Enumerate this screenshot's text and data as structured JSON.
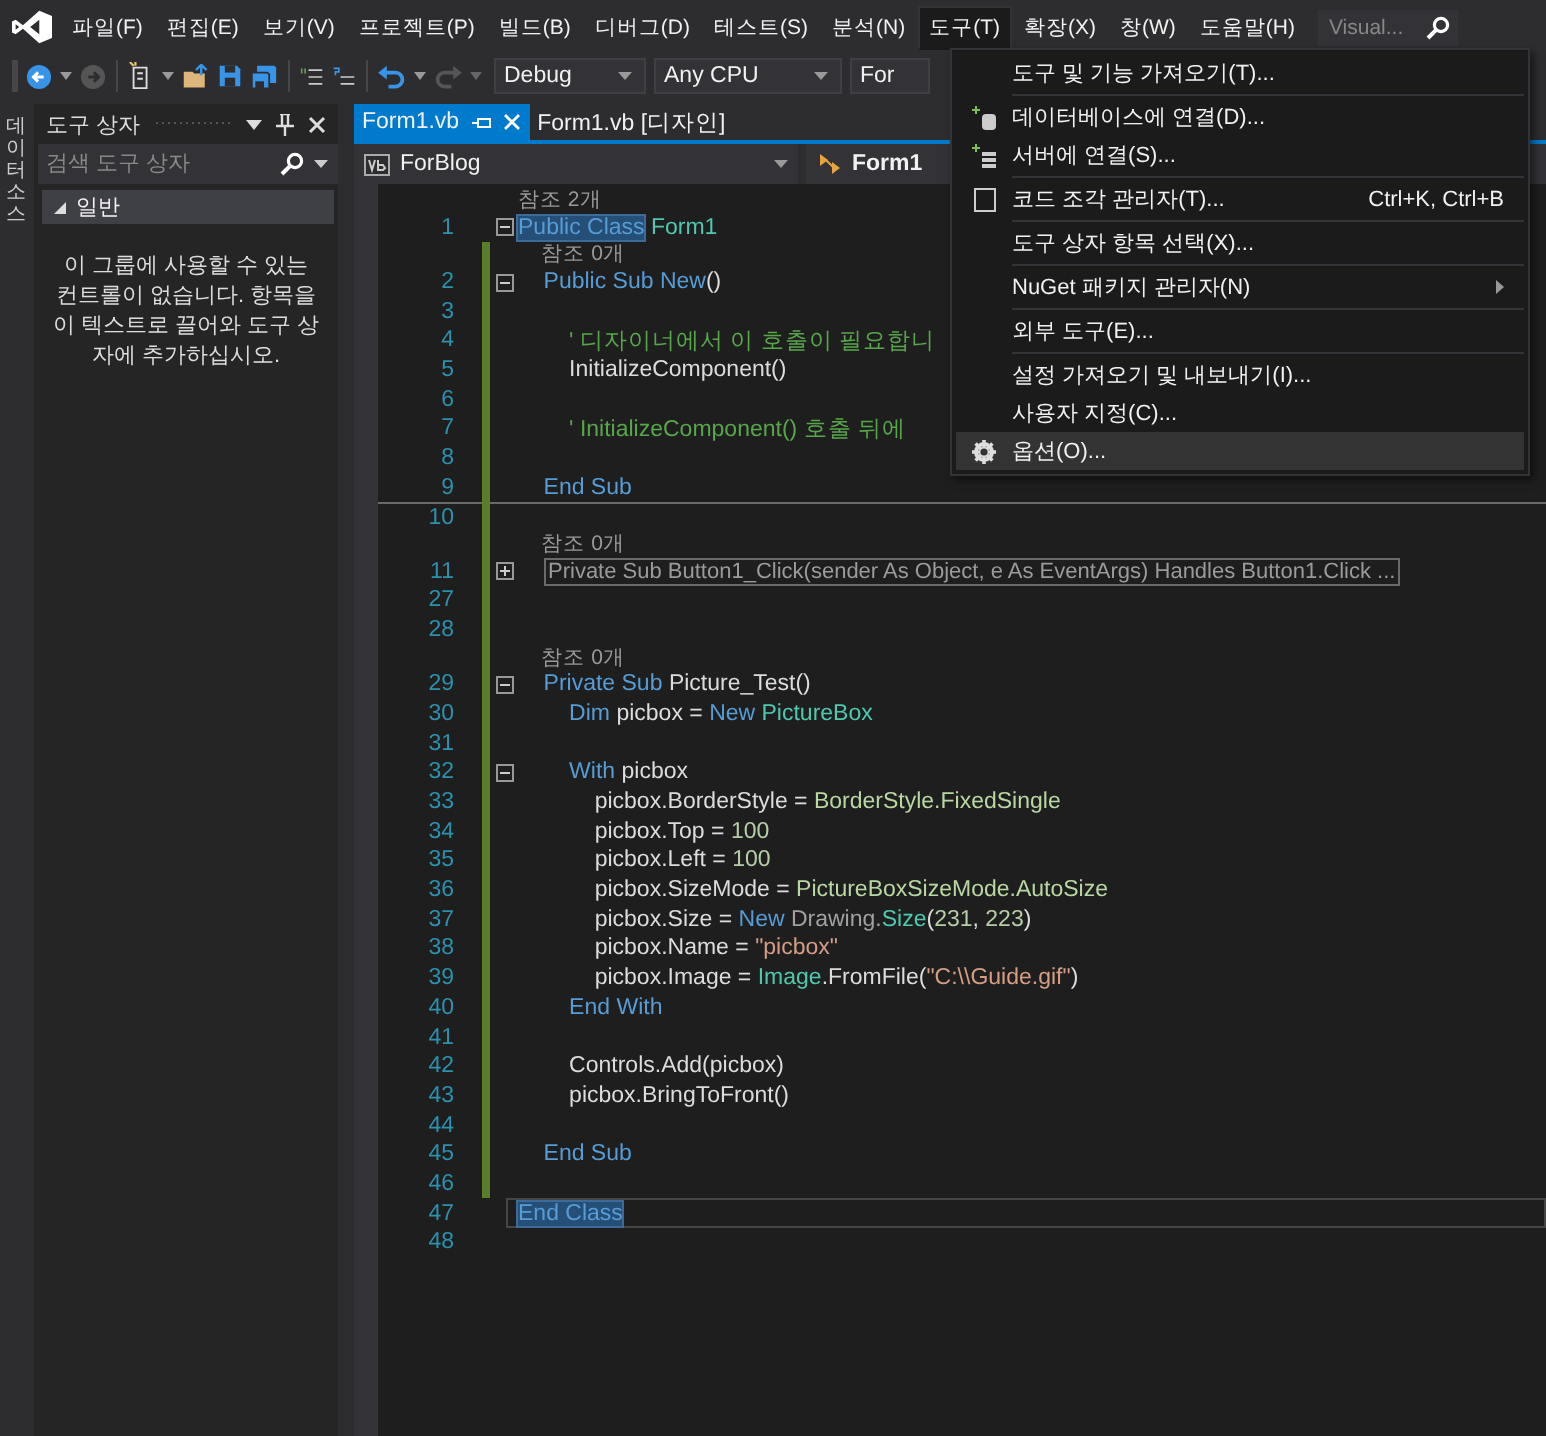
{
  "menubar": {
    "items": [
      {
        "label": "파일(F)",
        "selected": false
      },
      {
        "label": "편집(E)",
        "selected": false
      },
      {
        "label": "보기(V)",
        "selected": false
      },
      {
        "label": "프로젝트(P)",
        "selected": false
      },
      {
        "label": "빌드(B)",
        "selected": false
      },
      {
        "label": "디버그(D)",
        "selected": false
      },
      {
        "label": "테스트(S)",
        "selected": false
      },
      {
        "label": "분석(N)",
        "selected": false
      },
      {
        "label": "도구(T)",
        "selected": true
      },
      {
        "label": "확장(X)",
        "selected": false
      },
      {
        "label": "창(W)",
        "selected": false
      },
      {
        "label": "도움말(H)",
        "selected": false
      }
    ],
    "search": {
      "placeholder": "Visual..."
    }
  },
  "toolbar": {
    "dropdowns": [
      {
        "value": "Debug"
      },
      {
        "value": "Any CPU"
      },
      {
        "value": "For"
      }
    ]
  },
  "side_tab": {
    "label": "데이터 소스"
  },
  "toolbox": {
    "title": "도구 상자",
    "search": {
      "placeholder": "검색 도구 상자"
    },
    "group": {
      "label": "일반",
      "expanded": true
    },
    "message": "이 그룹에 사용할 수 있는 컨트롤이 없습니다. 항목을 이 텍스트로 끌어와 도구 상자에 추가하십시오."
  },
  "editor": {
    "tabs": [
      {
        "label": "Form1.vb",
        "selected": true
      },
      {
        "label": "Form1.vb [디자인]",
        "selected": false
      }
    ],
    "nav": {
      "project": "ForBlog",
      "class": "Form1"
    },
    "rows": [
      {
        "kind": "lens",
        "text": "참조 2개",
        "changed": false
      },
      {
        "kind": "code",
        "number": "1",
        "expanded": true,
        "changed": false,
        "selected_text": "Public Class",
        "tokens": [
          {
            "text": " Form1",
            "kind": "type"
          }
        ]
      },
      {
        "kind": "lens",
        "text": "    참조 0개",
        "changed": true
      },
      {
        "kind": "code",
        "number": "2",
        "expanded": true,
        "changed": true,
        "tokens": [
          {
            "text": "    Public Sub New",
            "kind": "keyword"
          },
          {
            "text": "()",
            "kind": "plain"
          }
        ]
      },
      {
        "kind": "code",
        "number": "3",
        "changed": true,
        "tokens": []
      },
      {
        "kind": "code",
        "number": "4",
        "changed": true,
        "tokens": [
          {
            "text": "        ' 디자이너에서 이 호출이 필요합니",
            "kind": "comment"
          }
        ]
      },
      {
        "kind": "code",
        "number": "5",
        "changed": true,
        "tokens": [
          {
            "text": "        InitializeComponent()",
            "kind": "plain"
          }
        ]
      },
      {
        "kind": "code",
        "number": "6",
        "changed": true,
        "tokens": []
      },
      {
        "kind": "code",
        "number": "7",
        "changed": true,
        "tokens": [
          {
            "text": "        ' InitializeComponent() 호출 뒤에",
            "kind": "comment"
          }
        ]
      },
      {
        "kind": "code",
        "number": "8",
        "changed": true,
        "tokens": []
      },
      {
        "kind": "code",
        "number": "9",
        "changed": true,
        "tokens": [
          {
            "text": "    End Sub",
            "kind": "keyword"
          }
        ]
      },
      {
        "kind": "code",
        "number": "10",
        "changed": true,
        "separator_above": true,
        "tokens": []
      },
      {
        "kind": "lens",
        "text": "    참조 0개",
        "changed": true
      },
      {
        "kind": "code",
        "number": "11",
        "expanded": false,
        "changed": true,
        "tokens": [
          {
            "text": "Private Sub Button1_Click(sender As Object, e As EventArgs) Handles Button1.Click ...",
            "kind": "collapsed"
          }
        ]
      },
      {
        "kind": "code",
        "number": "27",
        "changed": true,
        "tokens": []
      },
      {
        "kind": "code",
        "number": "28",
        "changed": true,
        "tokens": []
      },
      {
        "kind": "lens",
        "text": "    참조 0개",
        "changed": true
      },
      {
        "kind": "code",
        "number": "29",
        "expanded": true,
        "changed": true,
        "tokens": [
          {
            "text": "    Private Sub ",
            "kind": "keyword"
          },
          {
            "text": "Picture_Test()",
            "kind": "plain"
          }
        ]
      },
      {
        "kind": "code",
        "number": "30",
        "changed": true,
        "tokens": [
          {
            "text": "        Dim ",
            "kind": "keyword"
          },
          {
            "text": "picbox = ",
            "kind": "plain"
          },
          {
            "text": "New ",
            "kind": "keyword"
          },
          {
            "text": "PictureBox",
            "kind": "type"
          }
        ]
      },
      {
        "kind": "code",
        "number": "31",
        "changed": true,
        "tokens": []
      },
      {
        "kind": "code",
        "number": "32",
        "expanded": true,
        "changed": true,
        "tokens": [
          {
            "text": "        With ",
            "kind": "keyword"
          },
          {
            "text": "picbox",
            "kind": "plain"
          }
        ]
      },
      {
        "kind": "code",
        "number": "33",
        "changed": true,
        "tokens": [
          {
            "text": "            picbox.BorderStyle = ",
            "kind": "plain"
          },
          {
            "text": "BorderStyle.FixedSingle",
            "kind": "enum"
          }
        ]
      },
      {
        "kind": "code",
        "number": "34",
        "changed": true,
        "tokens": [
          {
            "text": "            picbox.Top = ",
            "kind": "plain"
          },
          {
            "text": "100",
            "kind": "number"
          }
        ]
      },
      {
        "kind": "code",
        "number": "35",
        "changed": true,
        "tokens": [
          {
            "text": "            picbox.Left = ",
            "kind": "plain"
          },
          {
            "text": "100",
            "kind": "number"
          }
        ]
      },
      {
        "kind": "code",
        "number": "36",
        "changed": true,
        "tokens": [
          {
            "text": "            picbox.SizeMode = ",
            "kind": "plain"
          },
          {
            "text": "PictureBoxSizeMode.AutoSize",
            "kind": "enum"
          }
        ]
      },
      {
        "kind": "code",
        "number": "37",
        "changed": true,
        "tokens": [
          {
            "text": "            picbox.Size = ",
            "kind": "plain"
          },
          {
            "text": "New ",
            "kind": "keyword"
          },
          {
            "text": "Drawing.",
            "kind": "namespace"
          },
          {
            "text": "Size",
            "kind": "type"
          },
          {
            "text": "(",
            "kind": "plain"
          },
          {
            "text": "231",
            "kind": "number"
          },
          {
            "text": ", ",
            "kind": "plain"
          },
          {
            "text": "223",
            "kind": "number"
          },
          {
            "text": ")",
            "kind": "plain"
          }
        ]
      },
      {
        "kind": "code",
        "number": "38",
        "changed": true,
        "tokens": [
          {
            "text": "            picbox.Name = ",
            "kind": "plain"
          },
          {
            "text": "\"picbox\"",
            "kind": "string"
          }
        ]
      },
      {
        "kind": "code",
        "number": "39",
        "changed": true,
        "tokens": [
          {
            "text": "            picbox.Image = ",
            "kind": "plain"
          },
          {
            "text": "Image",
            "kind": "type"
          },
          {
            "text": ".FromFile(",
            "kind": "plain"
          },
          {
            "text": "\"C:\\\\Guide.gif\"",
            "kind": "string"
          },
          {
            "text": ")",
            "kind": "plain"
          }
        ]
      },
      {
        "kind": "code",
        "number": "40",
        "changed": true,
        "tokens": [
          {
            "text": "        End With",
            "kind": "keyword"
          }
        ]
      },
      {
        "kind": "code",
        "number": "41",
        "changed": true,
        "tokens": []
      },
      {
        "kind": "code",
        "number": "42",
        "changed": true,
        "tokens": [
          {
            "text": "        Controls.Add(picbox)",
            "kind": "plain"
          }
        ]
      },
      {
        "kind": "code",
        "number": "43",
        "changed": true,
        "tokens": [
          {
            "text": "        picbox.BringToFront()",
            "kind": "plain"
          }
        ]
      },
      {
        "kind": "code",
        "number": "44",
        "changed": true,
        "tokens": []
      },
      {
        "kind": "code",
        "number": "45",
        "changed": true,
        "tokens": [
          {
            "text": "    End Sub",
            "kind": "keyword"
          }
        ]
      },
      {
        "kind": "code",
        "number": "46",
        "changed": true,
        "tokens": []
      },
      {
        "kind": "code",
        "number": "47",
        "changed": false,
        "current_line": true,
        "selected_text": "End Class",
        "tokens": []
      },
      {
        "kind": "code",
        "number": "48",
        "changed": false,
        "tokens": []
      }
    ]
  },
  "menu": {
    "items": [
      {
        "label": "도구 및 기능 가져오기(T)...",
        "selected": false,
        "separator_after": true
      },
      {
        "label": "데이터베이스에 연결(D)...",
        "selected": false
      },
      {
        "label": "서버에 연결(S)...",
        "selected": false,
        "separator_after": true
      },
      {
        "label": "코드 조각 관리자(T)...",
        "shortcut": "Ctrl+K, Ctrl+B",
        "selected": false,
        "separator_after": true
      },
      {
        "label": "도구 상자 항목 선택(X)...",
        "selected": false,
        "separator_after": true
      },
      {
        "label": "NuGet 패키지 관리자(N)",
        "submenu": true,
        "selected": false,
        "separator_after": true
      },
      {
        "label": "외부 도구(E)...",
        "selected": false,
        "separator_after": true
      },
      {
        "label": "설정 가져오기 및 내보내기(I)...",
        "selected": false
      },
      {
        "label": "사용자 지정(C)...",
        "selected": false
      },
      {
        "label": "옵션(O)...",
        "selected": true
      }
    ]
  }
}
